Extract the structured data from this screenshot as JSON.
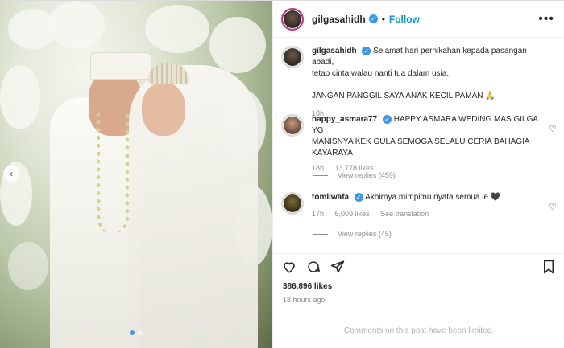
{
  "post": {
    "username": "gilgasahidh",
    "follow_label": "Follow",
    "more_label": "•••",
    "caption_line1": "Selamat hari pernikahan kepada pasangan abadi,",
    "caption_line2": "tetap cinta walau nanti tua dalam usia.",
    "caption_line3": "JANGAN PANGGIL SAYA ANAK KECIL PAMAN 🙏",
    "caption_time": "18h",
    "likes_text": "386,896 likes",
    "time_ago": "18 hours ago",
    "limited_text": "Comments on this post have been limited."
  },
  "comments": [
    {
      "username": "happy_asmara77",
      "text_line1": "HAPPY ASMARA WEDING MAS GILGA YG",
      "text_line2": "MANISNYA KEK GULA SEMOGA SELALU CERIA BAHAGIA",
      "text_line3": "KAYARAYA",
      "time": "18h",
      "likes": "13,778 likes",
      "replies": "View replies (459)"
    },
    {
      "username": "tomliwafa",
      "text_line1": "Akhirnya mimpimu nyata semua le 🖤",
      "time": "17h",
      "likes": "6,009 likes",
      "translate": "See translation",
      "replies": "View replies (45)"
    }
  ],
  "icons": {
    "verified": "verified-badge-icon",
    "heart": "heart-icon",
    "comment": "comment-icon",
    "share": "share-icon",
    "bookmark": "bookmark-icon",
    "prev": "chevron-left-icon"
  },
  "colors": {
    "accent": "#0095f6",
    "verified": "#3897f0",
    "muted": "#8e8e8e"
  }
}
